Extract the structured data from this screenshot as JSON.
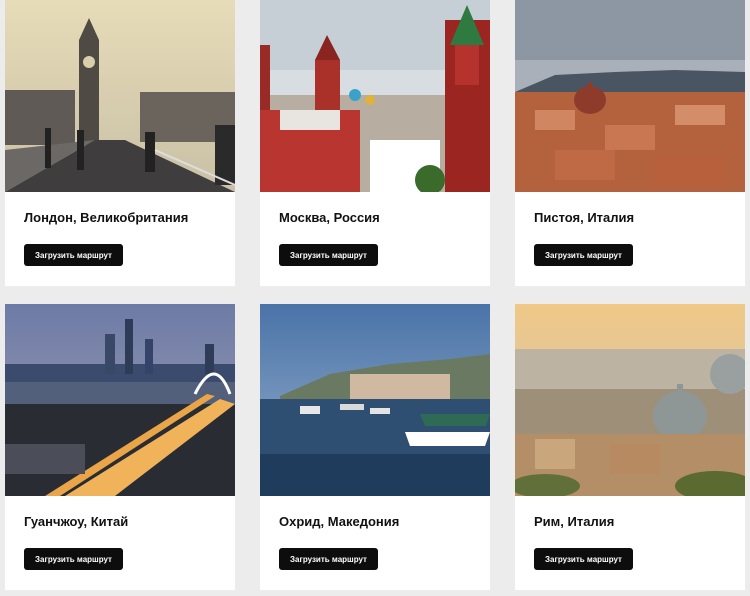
{
  "cards": [
    {
      "city": "Лондон, Великобритания",
      "button_label": "Загрузить маршрут"
    },
    {
      "city": "Москва, Россия",
      "button_label": "Загрузить маршрут"
    },
    {
      "city": "Пистоя, Италия",
      "button_label": "Загрузить маршрут"
    },
    {
      "city": "Гуанчжоу, Китай",
      "button_label": "Загрузить маршрут"
    },
    {
      "city": "Охрид, Македония",
      "button_label": "Загрузить маршрут"
    },
    {
      "city": "Рим, Италия",
      "button_label": "Загрузить маршрут"
    }
  ]
}
